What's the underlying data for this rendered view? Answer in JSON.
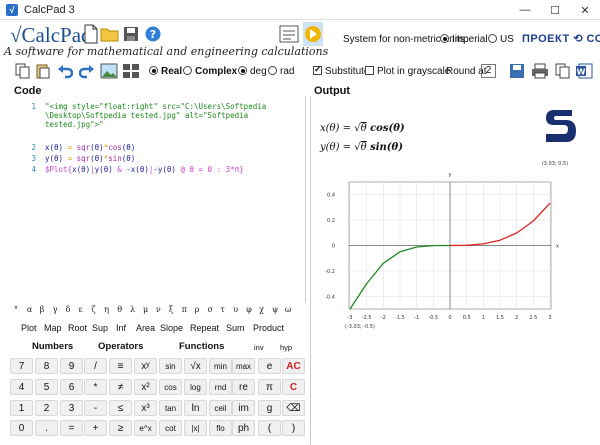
{
  "window": {
    "title": "CalcPad 3",
    "minimize": "—",
    "maximize": "☐",
    "close": "✕"
  },
  "header": {
    "logo": "√CalcPad",
    "logo_sup": "®",
    "tagline": "A software for mathematical and engineering calculations",
    "units_label": "System for non-metric units:",
    "units_options": [
      {
        "label": "Imperial",
        "selected": true
      },
      {
        "label": "US",
        "selected": false
      }
    ],
    "company": "ПРОЕКТ ⟲ СОФТ"
  },
  "toolbar": {
    "real_label": "Real",
    "complex_label": "Complex",
    "deg_label": "deg",
    "rad_label": "rad",
    "substitute_label": "Substitute",
    "substitute_checked": true,
    "grayscale_label": "Plot in grayscale",
    "grayscale_checked": false,
    "round_label": "Round at",
    "round_value": "2"
  },
  "code": {
    "label": "Code",
    "lines": [
      {
        "n": "1",
        "parts": [
          {
            "t": "\"<img style=\"float:right\" src=\"C:\\Users\\Softpedia",
            "c": "#1a8a1a"
          }
        ]
      },
      {
        "n": "",
        "parts": [
          {
            "t": "\\Desktop\\Softpedia tested.jpg\" alt=\"Softpedia",
            "c": "#1a8a1a"
          }
        ]
      },
      {
        "n": "",
        "parts": [
          {
            "t": "tested.jpg\">\"",
            "c": "#1a8a1a"
          }
        ]
      },
      {
        "n": "2",
        "parts": [
          {
            "t": "x",
            "c": "#1c1c9c"
          },
          {
            "t": "(θ)",
            "c": "#1c1c9c"
          },
          {
            "t": " = ",
            "c": "#c8a000"
          },
          {
            "t": "sqr",
            "c": "#aa2aaa"
          },
          {
            "t": "(θ)",
            "c": "#1c1c9c"
          },
          {
            "t": "*",
            "c": "#c8a000"
          },
          {
            "t": "cos",
            "c": "#aa2aaa"
          },
          {
            "t": "(θ)",
            "c": "#1c1c9c"
          }
        ]
      },
      {
        "n": "3",
        "parts": [
          {
            "t": "y",
            "c": "#1c1c9c"
          },
          {
            "t": "(θ)",
            "c": "#1c1c9c"
          },
          {
            "t": " = ",
            "c": "#c8a000"
          },
          {
            "t": "sqr",
            "c": "#aa2aaa"
          },
          {
            "t": "(θ)",
            "c": "#1c1c9c"
          },
          {
            "t": "*",
            "c": "#c8a000"
          },
          {
            "t": "sin",
            "c": "#aa2aaa"
          },
          {
            "t": "(θ)",
            "c": "#1c1c9c"
          }
        ]
      },
      {
        "n": "4",
        "parts": [
          {
            "t": "$Plot",
            "c": "#cc44cc"
          },
          {
            "t": "{",
            "c": "#cc44cc"
          },
          {
            "t": "x(θ)",
            "c": "#1c1c9c"
          },
          {
            "t": "|",
            "c": "#cc44cc"
          },
          {
            "t": "y(θ)",
            "c": "#1c1c9c"
          },
          {
            "t": " & ",
            "c": "#cc44cc"
          },
          {
            "t": "-x(θ)",
            "c": "#1c1c9c"
          },
          {
            "t": "|",
            "c": "#cc44cc"
          },
          {
            "t": "-y(θ)",
            "c": "#1c1c9c"
          },
          {
            "t": " @ θ = 0 : 3*π",
            "c": "#cc44cc"
          },
          {
            "t": "}",
            "c": "#cc44cc"
          }
        ]
      }
    ]
  },
  "output": {
    "label": "Output",
    "eq1": {
      "lhs": "x(θ) = ",
      "sqrt": "θ",
      "rhs": " cos(θ)"
    },
    "eq2": {
      "lhs": "y(θ) = ",
      "sqrt": "θ",
      "rhs": " sin(θ)"
    }
  },
  "greek": [
    "°",
    "α",
    "β",
    "γ",
    "δ",
    "ε",
    "ζ",
    "η",
    "θ",
    "λ",
    "μ",
    "ν",
    "ξ",
    "π",
    "ρ",
    "σ",
    "τ",
    "υ",
    "φ",
    "χ",
    "ψ",
    "ω"
  ],
  "functions": [
    "Plot",
    "Map",
    "Root",
    "Sup",
    "Inf",
    "Area",
    "Slope",
    "Repeat",
    "Sum",
    "Product"
  ],
  "keypad": {
    "headers": {
      "numbers": "Numbers",
      "operators": "Operators",
      "functions": "Functions",
      "inv": "inv",
      "hyp": "hyp"
    },
    "rows": [
      [
        "7",
        "8",
        "9",
        "/",
        "≡",
        "xʸ",
        "sin",
        "√x",
        "min",
        "max",
        "e",
        "AC"
      ],
      [
        "4",
        "5",
        "6",
        "*",
        "≠",
        "x²",
        "cos",
        "log",
        "rnd",
        "re",
        "π",
        "C"
      ],
      [
        "1",
        "2",
        "3",
        "-",
        "≤",
        "x³",
        "tan",
        "ln",
        "ceil",
        "im",
        "g",
        "⌫"
      ],
      [
        "0",
        ".",
        "=",
        "+",
        "≥",
        "e^x",
        "cot",
        "|x|",
        "flo",
        "ph",
        "(",
        ")"
      ]
    ]
  },
  "chart_data": {
    "type": "line",
    "title": "",
    "xlabel": "x",
    "ylabel": "y",
    "xlim": [
      -3.03,
      3.03
    ],
    "ylim": [
      -0.5,
      0.5
    ],
    "corner_labels": {
      "top_right": "(3.03; 0.5)",
      "bottom_left": "(-3.03; -0.5)"
    },
    "x_ticks": [
      -3,
      -2.5,
      -2,
      -1.5,
      -1,
      -0.5,
      0,
      0.5,
      1,
      1.5,
      2,
      2.5,
      3
    ],
    "y_ticks": [
      0.4,
      0.2,
      0,
      -0.2,
      -0.4
    ],
    "grid": true,
    "series": [
      {
        "color": "#dd2222",
        "x": [
          0,
          0.5,
          1,
          1.5,
          2,
          2.5,
          3
        ],
        "y": [
          0,
          0.0016,
          0.0123,
          0.0416,
          0.0987,
          0.1927,
          0.3331
        ]
      },
      {
        "color": "#228822",
        "x": [
          -3,
          -2.5,
          -2,
          -1.5,
          -1,
          -0.5,
          0
        ],
        "y": [
          -0.5,
          -0.3,
          -0.14,
          -0.05,
          -0.012,
          -0.001,
          0
        ]
      }
    ]
  }
}
